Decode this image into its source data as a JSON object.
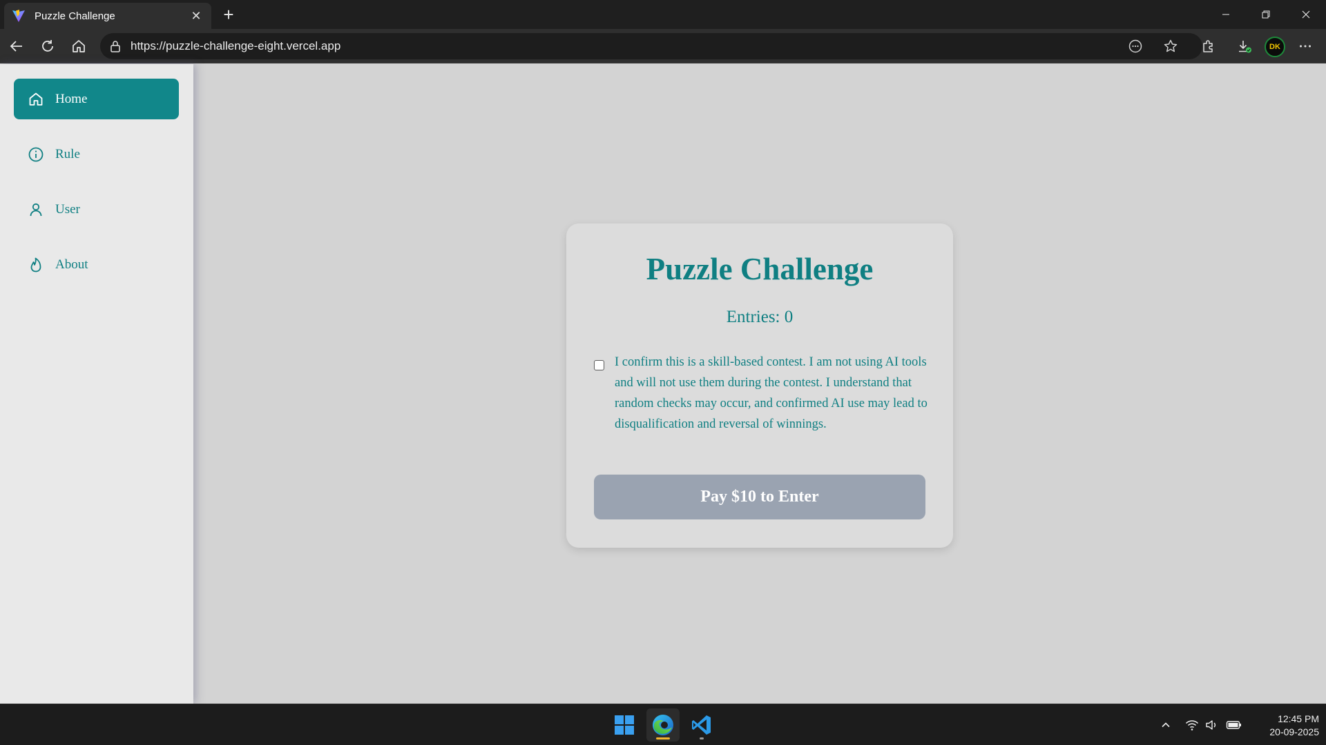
{
  "browser": {
    "tab_title": "Puzzle Challenge",
    "tab_close": "✕",
    "new_tab": "+",
    "url": "https://puzzle-challenge-eight.vercel.app",
    "profile_initials": "DK"
  },
  "sidebar": {
    "items": [
      {
        "label": "Home",
        "icon": "home-icon",
        "active": true
      },
      {
        "label": "Rule",
        "icon": "info-icon",
        "active": false
      },
      {
        "label": "User",
        "icon": "user-icon",
        "active": false
      },
      {
        "label": "About",
        "icon": "flame-icon",
        "active": false
      }
    ]
  },
  "card": {
    "title": "Puzzle Challenge",
    "entries": "Entries: 0",
    "confirm_text": "I confirm this is a skill-based contest. I am not using AI tools and will not use them during the contest. I understand that random checks may occur, and confirmed AI use may lead to disqualification and reversal of winnings.",
    "confirm_checked": false,
    "pay_button": "Pay $10 to Enter"
  },
  "taskbar": {
    "apps": [
      "windows-start-icon",
      "edge-icon",
      "vscode-icon"
    ],
    "time": "12:45 PM",
    "date": "20-09-2025"
  },
  "colors": {
    "accent": "#11878a",
    "text_teal": "#0f7f82",
    "button_disabled": "#9aa3b1",
    "background": "#d3d3d3"
  }
}
